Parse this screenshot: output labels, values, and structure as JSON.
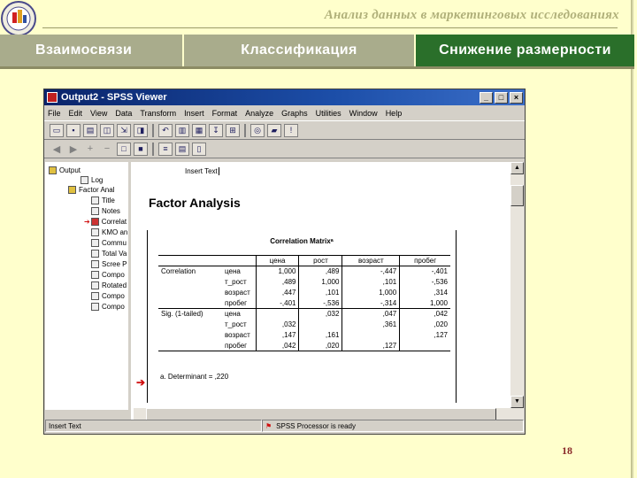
{
  "slide": {
    "title": "Анализ данных в маркетинговых исследованиях",
    "page_number": "18"
  },
  "tabs": [
    {
      "label": "Взаимосвязи"
    },
    {
      "label": "Классификация"
    },
    {
      "label": "Снижение размерности",
      "active": true
    }
  ],
  "window": {
    "title": "Output2 - SPSS Viewer",
    "controls": [
      "_",
      "□",
      "×"
    ]
  },
  "menu": [
    "File",
    "Edit",
    "View",
    "Data",
    "Transform",
    "Insert",
    "Format",
    "Analyze",
    "Graphs",
    "Utilities",
    "Window",
    "Help"
  ],
  "outline": [
    {
      "label": "Output"
    },
    {
      "label": "Log"
    },
    {
      "label": "Factor Anal"
    },
    {
      "label": "Title"
    },
    {
      "label": "Notes"
    },
    {
      "label": "Correlat"
    },
    {
      "label": "KMO an"
    },
    {
      "label": "Commu"
    },
    {
      "label": "Total Va"
    },
    {
      "label": "Scree P"
    },
    {
      "label": "Compo"
    },
    {
      "label": "Rotated"
    },
    {
      "label": "Compo"
    },
    {
      "label": "Compo"
    }
  ],
  "content": {
    "insert_text": "Insert Text",
    "heading": "Factor Analysis",
    "table_title": "Correlation Matrixᵃ",
    "columns": [
      "цена",
      "рост",
      "возраст",
      "пробег"
    ],
    "groups": [
      {
        "label": "Correlation",
        "rows": [
          {
            "name": "цена",
            "values": [
              "1,000",
              ",489",
              "-,447",
              "-,401"
            ]
          },
          {
            "name": "т_рост",
            "values": [
              ",489",
              "1,000",
              ",101",
              "-,536"
            ]
          },
          {
            "name": "возраст",
            "values": [
              ",447",
              ",101",
              "1,000",
              ",314"
            ]
          },
          {
            "name": "пробег",
            "values": [
              "-,401",
              "-,536",
              "-,314",
              "1,000"
            ]
          }
        ]
      },
      {
        "label": "Sig. (1-tailed)",
        "rows": [
          {
            "name": "цена",
            "values": [
              "",
              ",032",
              ",047",
              ",042"
            ]
          },
          {
            "name": "т_рост",
            "values": [
              ",032",
              "",
              ",361",
              ",020"
            ]
          },
          {
            "name": "возраст",
            "values": [
              ",147",
              ",161",
              "",
              ",127"
            ]
          },
          {
            "name": "пробег",
            "values": [
              ",042",
              ",020",
              ",127",
              ""
            ]
          }
        ]
      }
    ],
    "footnote": "a. Determinant = ,220"
  },
  "status": {
    "left": "Insert Text",
    "right": "SPSS Processor  is ready"
  }
}
